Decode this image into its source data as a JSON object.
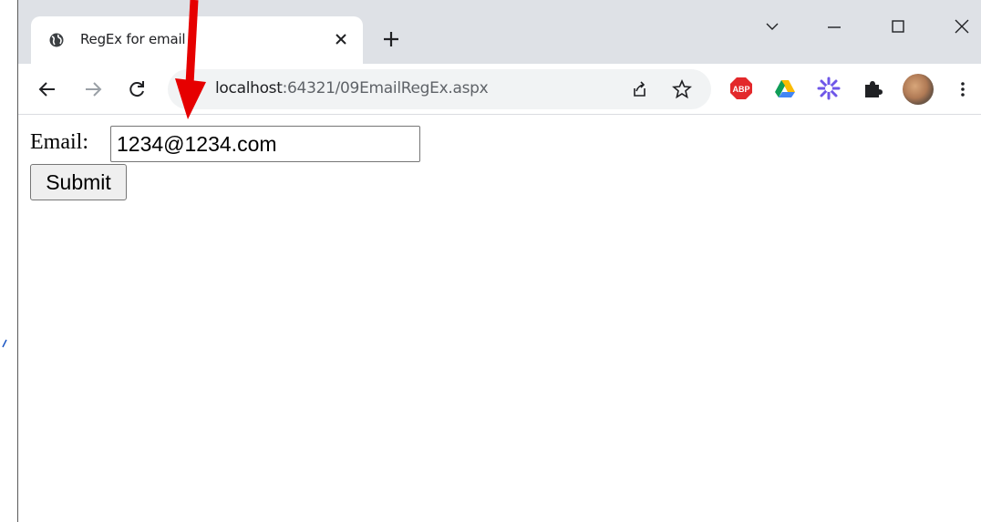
{
  "browser": {
    "tab": {
      "title": "RegEx for email",
      "icon": "globe-icon"
    },
    "new_tab_icon": "plus-icon",
    "window_controls": [
      "chevron-down-icon",
      "minimize-icon",
      "maximize-icon",
      "close-icon"
    ],
    "address": {
      "host": "localhost",
      "path": ":64321/09EmailRegEx.aspx"
    },
    "extensions": [
      "adblock-plus-icon",
      "google-drive-icon",
      "sparkle-extension-icon",
      "puzzle-icon"
    ],
    "abp_label": "ABP"
  },
  "form": {
    "email_label": "Email:",
    "email_value": "1234@1234.com",
    "submit_label": "Submit"
  },
  "colors": {
    "annotation_arrow": "#e60000",
    "tab_strip": "#dee1e6",
    "omnibox": "#f1f3f4"
  }
}
